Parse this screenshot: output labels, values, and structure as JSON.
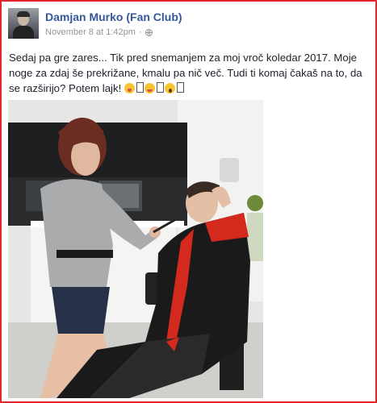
{
  "post": {
    "author": "Damjan Murko (Fan Club)",
    "timestamp": "November 8 at 1:42pm",
    "separator": "·",
    "privacy_icon": "globe-icon",
    "text": "Sedaj pa gre zares... Tik pred snemanjem za moj vroč koledar 2017. Moje noge za zdaj še prekrižane, kmalu pa nič več. Tudi ti komaj čakaš na to, da se razširijo? Potem lajk!",
    "emojis": [
      "squinting-tongue-emoji",
      "winking-tongue-emoji",
      "screaming-face-emoji"
    ]
  },
  "colors": {
    "frame": "#e3262b",
    "author_link": "#365899",
    "meta": "#90949c",
    "text": "#1d2129",
    "robe_red": "#d42a1e",
    "robe_black": "#1a1a1a"
  }
}
